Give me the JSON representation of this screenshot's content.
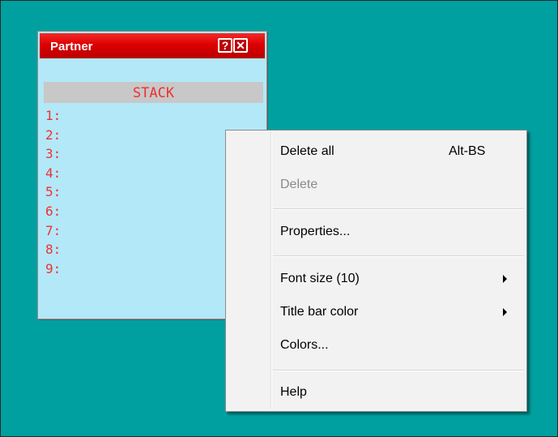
{
  "partner_window": {
    "title": "Partner",
    "help_button": "?",
    "close_button": "✕",
    "stack_header": "STACK",
    "stack_rows": [
      "1:",
      "2:",
      "3:",
      "4:",
      "5:",
      "6:",
      "7:",
      "8:",
      "9:"
    ]
  },
  "context_menu": {
    "delete_all": {
      "label": "Delete all",
      "shortcut": "Alt-BS"
    },
    "delete": {
      "label": "Delete",
      "enabled": false
    },
    "properties": {
      "label": "Properties..."
    },
    "font_size": {
      "label": "Font size (10)",
      "submenu": true
    },
    "title_bar_color": {
      "label": "Title bar color",
      "submenu": true
    },
    "colors": {
      "label": "Colors..."
    },
    "help": {
      "label": "Help"
    }
  },
  "colors": {
    "desktop": "#00a0a0",
    "window_body": "#b3e8f8",
    "titlebar": "#dd0000",
    "stack_text": "#f03030",
    "menu_background": "#f2f2f2"
  }
}
